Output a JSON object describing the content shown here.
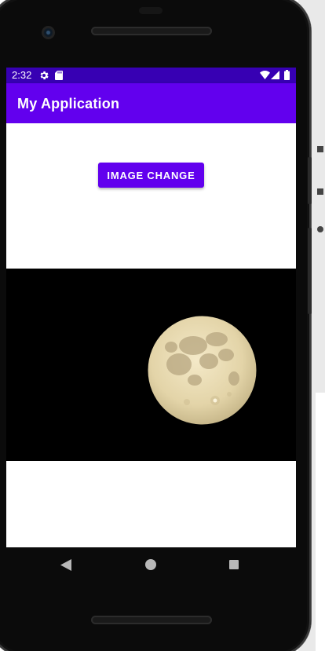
{
  "status_bar": {
    "time": "2:32",
    "background": "#3700b3",
    "icons": [
      "gear-icon",
      "sdcard-icon",
      "wifi-icon",
      "signal-icon",
      "battery-icon"
    ]
  },
  "app_bar": {
    "title": "My Application",
    "background": "#6200ee"
  },
  "main": {
    "button_label": "IMAGE CHANGE",
    "button_color": "#6200ee",
    "image": {
      "subject": "full moon",
      "background": "#000000"
    }
  },
  "nav_bar": {
    "buttons": [
      "back-icon",
      "home-icon",
      "recents-icon"
    ]
  },
  "colors": {
    "primary": "#6200ee",
    "primary_dark": "#3700b3"
  }
}
